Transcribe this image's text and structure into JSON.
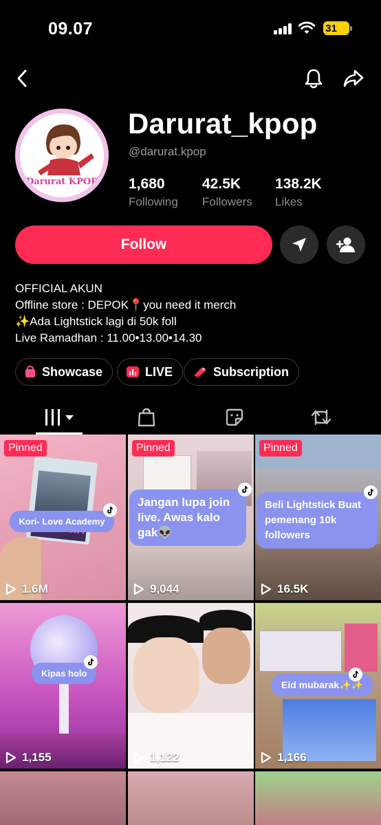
{
  "status_bar": {
    "time": "09.07",
    "battery": "31"
  },
  "profile": {
    "username": "Darurat_kpop",
    "handle": "@darurat.kpop",
    "avatar_text": "Darurat KPOP",
    "stats": [
      {
        "value": "1,680",
        "label": "Following"
      },
      {
        "value": "42.5K",
        "label": "Followers"
      },
      {
        "value": "138.2K",
        "label": "Likes"
      }
    ],
    "follow_label": "Follow",
    "bio": [
      "OFFICIAL AKUN",
      "Offline store : DEPOK📍you need it merch",
      "✨Ada Lightstick lagi di 50k foll",
      "Live Ramadhan : 11.00•13.00•14.30"
    ],
    "chips": [
      {
        "label": "Showcase",
        "icon": "shopping-bag-icon"
      },
      {
        "label": "LIVE",
        "icon": "live-icon"
      },
      {
        "label": "Subscription",
        "icon": "subscription-icon"
      }
    ]
  },
  "tabs": [
    {
      "name": "videos",
      "icon": "grid-icon"
    },
    {
      "name": "shop",
      "icon": "bag-icon"
    },
    {
      "name": "favorites",
      "icon": "sticker-icon"
    },
    {
      "name": "reposts",
      "icon": "repost-icon"
    }
  ],
  "videos": [
    {
      "pinned": "Pinned",
      "overlay": "Kori- Love Academy",
      "views": "1.6M"
    },
    {
      "pinned": "Pinned",
      "overlay": "Jangan lupa join live. Awas kalo gak👽",
      "views": "9,044"
    },
    {
      "pinned": "Pinned",
      "overlay": "Beli Lightstick Buat pemenang 10k followers",
      "views": "16.5K"
    },
    {
      "pinned": "",
      "overlay": "Kipas holo",
      "views": "1,155"
    },
    {
      "pinned": "",
      "overlay": "",
      "views": "1,122"
    },
    {
      "pinned": "",
      "overlay": "Eid mubarak✨✨",
      "views": "1,166"
    }
  ],
  "colors": {
    "accent": "#fe2c55",
    "overlay": "#8a93ee",
    "chip_border": "#3c3c3c"
  }
}
